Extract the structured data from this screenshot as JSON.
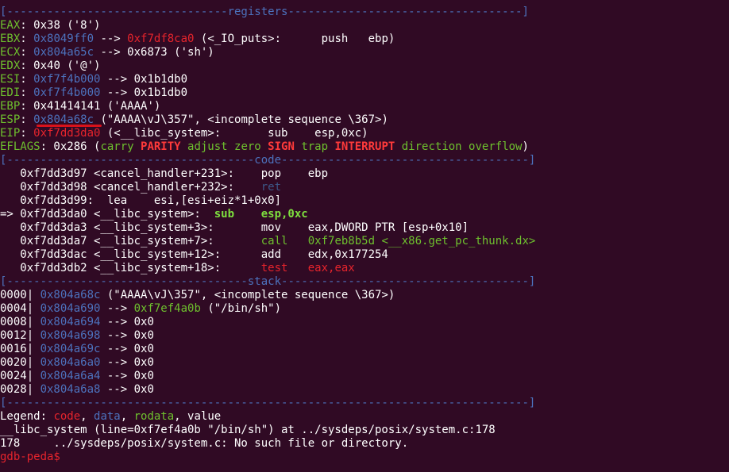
{
  "colors": {
    "background": "#300a24",
    "label": "#6ec02e",
    "address_data": "#4c72bd",
    "address_code": "#e6242c",
    "text": "#ffffff"
  },
  "lines": [
    [
      [
        "[---------------------------------",
        "blue"
      ],
      [
        "registers",
        "blue"
      ],
      [
        "-----------------------------------]",
        "blue"
      ]
    ],
    [
      [
        "EAX",
        "green"
      ],
      [
        ": 0x38 ('8')",
        "white"
      ]
    ],
    [
      [
        "EBX",
        "green"
      ],
      [
        ": ",
        "white"
      ],
      [
        "0x8049ff0",
        "blue"
      ],
      [
        " --> ",
        "white"
      ],
      [
        "0xf7df8ca0",
        "red"
      ],
      [
        " (<_IO_puts>:      push   ebp)",
        "white"
      ]
    ],
    [
      [
        "ECX",
        "green"
      ],
      [
        ": ",
        "white"
      ],
      [
        "0x804a65c",
        "blue"
      ],
      [
        " --> 0x6873 ('sh')",
        "white"
      ]
    ],
    [
      [
        "EDX",
        "green"
      ],
      [
        ": 0x40 ('@')",
        "white"
      ]
    ],
    [
      [
        "ESI",
        "green"
      ],
      [
        ": ",
        "white"
      ],
      [
        "0xf7f4b000",
        "blue"
      ],
      [
        " --> 0x1b1db0",
        "white"
      ]
    ],
    [
      [
        "EDI",
        "green"
      ],
      [
        ": ",
        "white"
      ],
      [
        "0xf7f4b000",
        "blue"
      ],
      [
        " --> 0x1b1db0",
        "white"
      ]
    ],
    [
      [
        "EBP",
        "green"
      ],
      [
        ": 0x41414141 ('AAAA')",
        "white"
      ]
    ],
    [
      [
        "ESP",
        "green"
      ],
      [
        ": ",
        "white"
      ],
      [
        "0x804a68c",
        "blue"
      ],
      [
        " (\"AAAA\\vJ\\357\", <incomplete sequence \\367>)",
        "white"
      ]
    ],
    [
      [
        "EIP",
        "green"
      ],
      [
        ": ",
        "white"
      ],
      [
        "0xf7dd3da0",
        "red"
      ],
      [
        " (<__libc_system>:       sub    esp,0xc)",
        "white"
      ]
    ],
    [
      [
        "EFLAGS",
        "green"
      ],
      [
        ": 0x286 (",
        "white"
      ],
      [
        "carry ",
        "green"
      ],
      [
        "PARITY",
        "bold-red"
      ],
      [
        " adjust zero ",
        "green"
      ],
      [
        "SIGN",
        "bold-red"
      ],
      [
        " trap ",
        "green"
      ],
      [
        "INTERRUPT",
        "bold-red"
      ],
      [
        " direction overflow",
        "green"
      ],
      [
        ")",
        "white"
      ]
    ],
    [
      [
        "[-------------------------------------",
        "blue"
      ],
      [
        "code",
        "blue"
      ],
      [
        "-------------------------------------]",
        "blue"
      ]
    ],
    [
      [
        "   0xf7dd3d97 <cancel_handler+231>:    pop    ebp",
        "white"
      ]
    ],
    [
      [
        "   0xf7dd3d98 <cancel_handler+232>:    ",
        "white"
      ],
      [
        "ret",
        "dim"
      ]
    ],
    [
      [
        "   0xf7dd3d99:  lea    esi,[esi+eiz*1+0x0]",
        "white"
      ]
    ],
    [
      [
        "=> 0xf7dd3da0 <__libc_system>:  ",
        "white"
      ],
      [
        "sub    esp,0xc",
        "bold-green"
      ]
    ],
    [
      [
        "   0xf7dd3da3 <__libc_system+3>:       mov    eax,DWORD PTR [esp+0x10]",
        "white"
      ]
    ],
    [
      [
        "   0xf7dd3da7 <__libc_system+7>:       ",
        "white"
      ],
      [
        "call   0xf7eb8b5d <__x86.get_pc_thunk.dx>",
        "green"
      ]
    ],
    [
      [
        "   0xf7dd3dac <__libc_system+12>:      add    edx,0x177254",
        "white"
      ]
    ],
    [
      [
        "   0xf7dd3db2 <__libc_system+18>:      ",
        "white"
      ],
      [
        "test   eax,eax",
        "red"
      ]
    ],
    [
      [
        "[------------------------------------",
        "blue"
      ],
      [
        "stack",
        "blue"
      ],
      [
        "-------------------------------------]",
        "blue"
      ]
    ],
    [
      [
        "0000| ",
        "white"
      ],
      [
        "0x804a68c",
        "blue"
      ],
      [
        " (\"AAAA\\vJ\\357\", <incomplete sequence \\367>)",
        "white"
      ]
    ],
    [
      [
        "0004| ",
        "white"
      ],
      [
        "0x804a690",
        "blue"
      ],
      [
        " --> ",
        "white"
      ],
      [
        "0xf7ef4a0b",
        "green"
      ],
      [
        " (\"/bin/sh\")",
        "white"
      ]
    ],
    [
      [
        "0008| ",
        "white"
      ],
      [
        "0x804a694",
        "blue"
      ],
      [
        " --> 0x0",
        "white"
      ]
    ],
    [
      [
        "0012| ",
        "white"
      ],
      [
        "0x804a698",
        "blue"
      ],
      [
        " --> 0x0",
        "white"
      ]
    ],
    [
      [
        "0016| ",
        "white"
      ],
      [
        "0x804a69c",
        "blue"
      ],
      [
        " --> 0x0",
        "white"
      ]
    ],
    [
      [
        "0020| ",
        "white"
      ],
      [
        "0x804a6a0",
        "blue"
      ],
      [
        " --> 0x0",
        "white"
      ]
    ],
    [
      [
        "0024| ",
        "white"
      ],
      [
        "0x804a6a4",
        "blue"
      ],
      [
        " --> 0x0",
        "white"
      ]
    ],
    [
      [
        "0028| ",
        "white"
      ],
      [
        "0x804a6a8",
        "blue"
      ],
      [
        " --> 0x0",
        "white"
      ]
    ],
    [
      [
        "[------------------------------------------------------------------------------]",
        "blue"
      ]
    ],
    [
      [
        "Legend: ",
        "white"
      ],
      [
        "code",
        "red"
      ],
      [
        ", ",
        "white"
      ],
      [
        "data",
        "blue"
      ],
      [
        ", ",
        "white"
      ],
      [
        "rodata",
        "green"
      ],
      [
        ", value",
        "white"
      ]
    ],
    [
      [
        "__libc_system (line=0xf7ef4a0b \"/bin/sh\") at ../sysdeps/posix/system.c:178",
        "white"
      ]
    ],
    [
      [
        "178     ../sysdeps/posix/system.c: No such file or directory.",
        "white"
      ]
    ],
    [
      [
        "gdb-peda$ ",
        "red"
      ]
    ]
  ]
}
